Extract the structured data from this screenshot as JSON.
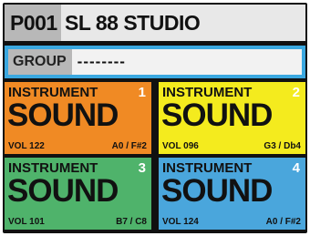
{
  "header": {
    "program_number": "P001",
    "program_name": "SL 88 STUDIO"
  },
  "group": {
    "label": "GROUP",
    "value": "--------"
  },
  "pads": [
    {
      "instrument_label": "INSTRUMENT",
      "number": "1",
      "sound": "SOUND",
      "volume": "VOL 122",
      "range": "A0 / F#2",
      "color": "#f08a24"
    },
    {
      "instrument_label": "INSTRUMENT",
      "number": "2",
      "sound": "SOUND",
      "volume": "VOL 096",
      "range": "G3 / Db4",
      "color": "#f4eb1e"
    },
    {
      "instrument_label": "INSTRUMENT",
      "number": "3",
      "sound": "SOUND",
      "volume": "VOL 101",
      "range": "B7 / C8",
      "color": "#4fb36b"
    },
    {
      "instrument_label": "INSTRUMENT",
      "number": "4",
      "sound": "SOUND",
      "volume": "VOL 124",
      "range": "A0 / F#2",
      "color": "#4aa6dc"
    }
  ]
}
